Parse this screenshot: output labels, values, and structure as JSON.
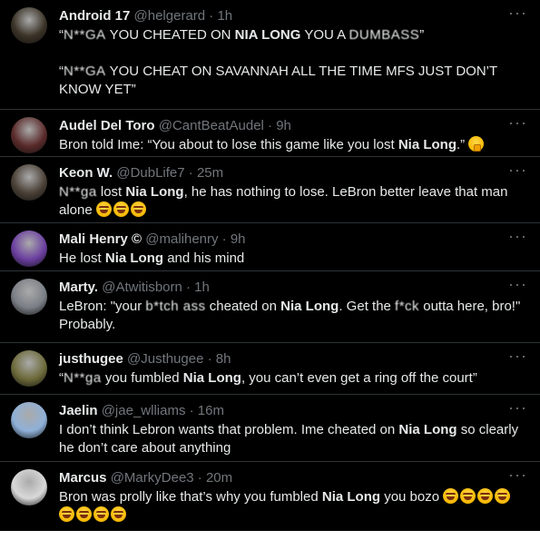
{
  "tweets": [
    {
      "name": "Android 17",
      "handle": "@helgerard · 1h",
      "segments": [
        {
          "t": "text",
          "v": "“"
        },
        {
          "t": "censor",
          "v": "N**GA"
        },
        {
          "t": "text",
          "v": " YOU CHEATED ON "
        },
        {
          "t": "bold",
          "v": "NIA LONG"
        },
        {
          "t": "text",
          "v": " YOU A "
        },
        {
          "t": "censor",
          "v": "DUMBASS"
        },
        {
          "t": "text",
          "v": "”"
        },
        {
          "t": "br"
        },
        {
          "t": "br"
        },
        {
          "t": "text",
          "v": "“"
        },
        {
          "t": "censor",
          "v": "N**GA"
        },
        {
          "t": "text",
          "v": " YOU CHEAT ON SAVANNAH ALL THE TIME MFS JUST DON’T KNOW YET”"
        }
      ],
      "avatar_color": "#3a3226"
    },
    {
      "name": "Audel Del Toro",
      "handle": "@CantBeatAudel · 9h",
      "segments": [
        {
          "t": "text",
          "v": "Bron told Ime: “You about to lose this game like you lost "
        },
        {
          "t": "bold",
          "v": "Nia Long"
        },
        {
          "t": "text",
          "v": ".” "
        },
        {
          "t": "emoji",
          "v": "hush"
        }
      ],
      "avatar_color": "#5a2a2a"
    },
    {
      "name": "Keon W.",
      "handle": "@DubLife7 · 25m",
      "segments": [
        {
          "t": "censor",
          "v": "N**ga"
        },
        {
          "t": "text",
          "v": " lost "
        },
        {
          "t": "bold",
          "v": "Nia Long"
        },
        {
          "t": "text",
          "v": ", he has nothing to lose. LeBron better leave that man alone "
        },
        {
          "t": "emoji",
          "v": "laugh"
        },
        {
          "t": "emoji",
          "v": "laugh"
        },
        {
          "t": "emoji",
          "v": "laugh"
        }
      ],
      "avatar_color": "#4a4036"
    },
    {
      "name": "Mali Henry ©",
      "handle": "@malihenry · 9h",
      "segments": [
        {
          "t": "text",
          "v": "He lost "
        },
        {
          "t": "bold",
          "v": "Nia Long"
        },
        {
          "t": "text",
          "v": " and his mind"
        }
      ],
      "avatar_color": "#6b3fa0"
    },
    {
      "name": "Marty.",
      "handle": "@Atwitisborn · 1h",
      "segments": [
        {
          "t": "text",
          "v": "LeBron: \"your "
        },
        {
          "t": "censor",
          "v": "b*tch ass"
        },
        {
          "t": "text",
          "v": " cheated on "
        },
        {
          "t": "bold",
          "v": "Nia Long"
        },
        {
          "t": "text",
          "v": ". Get the "
        },
        {
          "t": "censor",
          "v": "f*ck"
        },
        {
          "t": "text",
          "v": " outta here, bro!\" Probably."
        }
      ],
      "avatar_color": "#7a7f86"
    },
    {
      "name": "justhugee",
      "handle": "@Justhugee · 8h",
      "segments": [
        {
          "t": "text",
          "v": "“"
        },
        {
          "t": "censor",
          "v": "N**ga"
        },
        {
          "t": "text",
          "v": " you fumbled "
        },
        {
          "t": "bold",
          "v": "Nia Long"
        },
        {
          "t": "text",
          "v": ", you can’t even get a ring off the court”"
        }
      ],
      "avatar_color": "#6d6a3a"
    },
    {
      "name": "Jaelin",
      "handle": "@jae_wlliams · 16m",
      "segments": [
        {
          "t": "text",
          "v": "I don’t think Lebron wants that problem. Ime cheated on "
        },
        {
          "t": "bold",
          "v": "Nia Long"
        },
        {
          "t": "text",
          "v": " so clearly he don’t care about anything"
        }
      ],
      "avatar_color": "#8fb0d8"
    },
    {
      "name": "Marcus",
      "handle": "@MarkyDee3 · 20m",
      "segments": [
        {
          "t": "text",
          "v": "Bron was prolly like that’s why you fumbled "
        },
        {
          "t": "bold",
          "v": "Nia Long"
        },
        {
          "t": "text",
          "v": " you bozo "
        },
        {
          "t": "emoji",
          "v": "laugh"
        },
        {
          "t": "emoji",
          "v": "laugh"
        },
        {
          "t": "emoji",
          "v": "laugh"
        },
        {
          "t": "emoji",
          "v": "laugh"
        },
        {
          "t": "emoji",
          "v": "laugh"
        },
        {
          "t": "emoji",
          "v": "laugh"
        },
        {
          "t": "emoji",
          "v": "laugh"
        },
        {
          "t": "emoji",
          "v": "laugh"
        }
      ],
      "avatar_color": "#d9d9d9"
    }
  ],
  "more_icon": "ellipsis-icon",
  "colors": {
    "background": "#000000",
    "text": "#e7e9ea",
    "muted": "#71767b",
    "divider": "#2f3336"
  }
}
